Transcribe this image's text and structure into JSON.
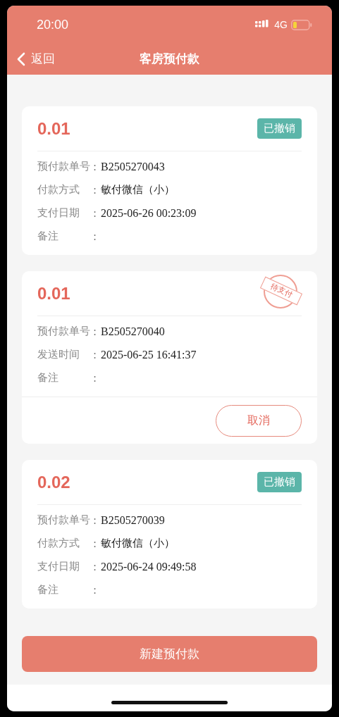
{
  "status_bar": {
    "time": "20:00",
    "network": "4G"
  },
  "nav": {
    "back": "返回",
    "title": "客房预付款"
  },
  "cards": [
    {
      "amount": "0.01",
      "status": {
        "kind": "badge",
        "text": "已撤销"
      },
      "rows": [
        {
          "label": "预付款单号",
          "separator": ":",
          "value": "B2505270043",
          "kind": "code"
        },
        {
          "label": "付款方式",
          "separator": ":",
          "value": "敏付微信（小）",
          "kind": "text"
        },
        {
          "label": "支付日期",
          "separator": ":",
          "value": "2025-06-26 00:23:09",
          "kind": "code"
        },
        {
          "label": "备注",
          "separator": ":"
        }
      ]
    },
    {
      "amount": "0.01",
      "status": {
        "kind": "stamp",
        "text": "待支付"
      },
      "rows": [
        {
          "label": "预付款单号",
          "separator": ":",
          "value": "B2505270040",
          "kind": "code"
        },
        {
          "label": "发送时间",
          "separator": ":",
          "value": "2025-06-25 16:41:37",
          "kind": "code"
        },
        {
          "label": "备注",
          "separator": ":"
        }
      ],
      "action": "取消"
    },
    {
      "amount": "0.02",
      "status": {
        "kind": "badge",
        "text": "已撤销"
      },
      "rows": [
        {
          "label": "预付款单号",
          "separator": ":",
          "value": "B2505270039",
          "kind": "code"
        },
        {
          "label": "付款方式",
          "separator": ":",
          "value": "敏付微信（小）",
          "kind": "text"
        },
        {
          "label": "支付日期",
          "separator": ":",
          "value": "2025-06-24 09:49:58",
          "kind": "code"
        },
        {
          "label": "备注",
          "separator": ":"
        }
      ]
    }
  ],
  "primary_button": "新建预付款"
}
